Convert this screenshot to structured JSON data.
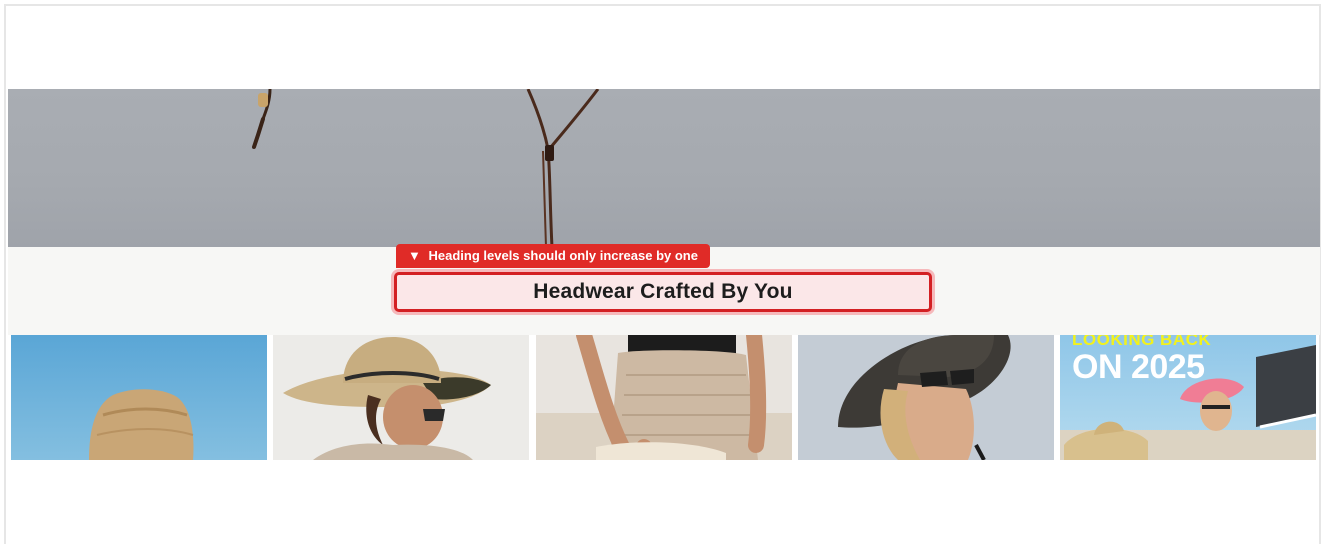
{
  "accessibility_overlay": {
    "marker": "▼",
    "message": "Heading levels should only increase by one",
    "color": "#e02b27"
  },
  "section": {
    "heading": "Headwear Crafted By You"
  },
  "gallery": {
    "promo": {
      "line1": "LOOKING BACK",
      "line2": "ON 2025",
      "line1_color": "#f2f21c",
      "line2_color": "#ffffff"
    }
  }
}
